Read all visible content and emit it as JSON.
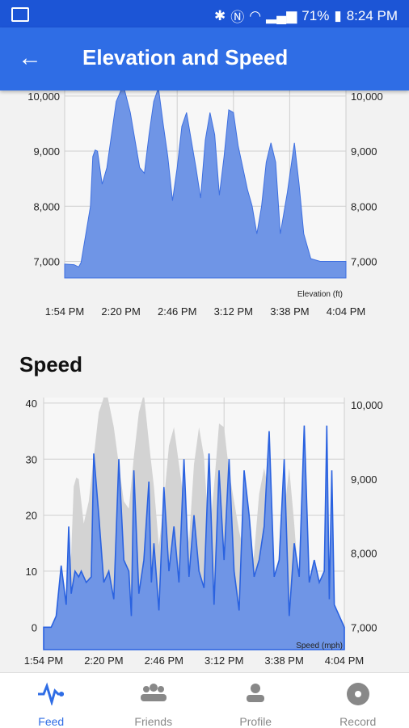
{
  "status": {
    "battery": "71%",
    "time": "8:24 PM"
  },
  "appbar": {
    "title": "Elevation and Speed",
    "back_icon": "arrow-left-icon"
  },
  "speed_section": {
    "title": "Speed"
  },
  "nav": [
    {
      "label": "Feed",
      "icon": "pulse-icon",
      "active": true
    },
    {
      "label": "Friends",
      "icon": "group-icon",
      "active": false
    },
    {
      "label": "Profile",
      "icon": "person-icon",
      "active": false
    },
    {
      "label": "Record",
      "icon": "record-icon",
      "active": false
    }
  ],
  "colors": {
    "accent": "#2f6de5",
    "elevation_fill": "#6f95e6",
    "speed_line": "#2a62e0",
    "elevation_bg": "#d3d3d3"
  },
  "chart_data": [
    {
      "type": "area",
      "caption": "Elevation (ft)",
      "x_ticks": [
        "1:54 PM",
        "2:20 PM",
        "2:46 PM",
        "3:12 PM",
        "3:38 PM",
        "4:04 PM"
      ],
      "y_ticks": [
        "7,000",
        "8,000",
        "9,000",
        "10,000"
      ],
      "ylim": [
        6700,
        10100
      ],
      "x_minutes": [
        0,
        8,
        12,
        14,
        22,
        24,
        26,
        28,
        32,
        36,
        40,
        44,
        50,
        56,
        60,
        64,
        68,
        72,
        76,
        80,
        84,
        88,
        92,
        96,
        100,
        104,
        108,
        112,
        116,
        120,
        124,
        128,
        132,
        136,
        140,
        144,
        148,
        152,
        156,
        160,
        164,
        168,
        172,
        176,
        180,
        184,
        190,
        196,
        200,
        204,
        210,
        218,
        222,
        226,
        230,
        236,
        240
      ],
      "elevation_ft": [
        6950,
        6940,
        6900,
        6980,
        8000,
        8900,
        9020,
        9000,
        8400,
        8700,
        9300,
        9900,
        10200,
        9700,
        9200,
        8700,
        8600,
        9300,
        9900,
        10150,
        9500,
        8900,
        8100,
        8700,
        9450,
        9700,
        9200,
        8700,
        8150,
        9200,
        9700,
        9300,
        8200,
        8900,
        9750,
        9700,
        9100,
        8700,
        8300,
        8000,
        7500,
        8000,
        8800,
        9150,
        8800,
        7500,
        8250,
        9150,
        8400,
        7500,
        7050,
        7000,
        7000,
        7000,
        7000,
        7000,
        7000
      ]
    },
    {
      "type": "line",
      "caption": "Speed (mph)",
      "x_ticks": [
        "1:54 PM",
        "2:20 PM",
        "2:46 PM",
        "3:12 PM",
        "3:38 PM",
        "4:04 PM"
      ],
      "y_left_ticks": [
        "0",
        "10",
        "20",
        "30",
        "40"
      ],
      "y_right_ticks": [
        "7,000",
        "8,000",
        "9,000",
        "10,000"
      ],
      "ylim_speed": [
        -4,
        41
      ],
      "ylim_elev": [
        6700,
        10100
      ],
      "x_minutes": [
        0,
        6,
        10,
        14,
        18,
        20,
        22,
        25,
        28,
        30,
        34,
        38,
        40,
        44,
        48,
        52,
        56,
        60,
        64,
        68,
        70,
        72,
        76,
        80,
        84,
        86,
        88,
        92,
        96,
        100,
        104,
        108,
        112,
        116,
        120,
        124,
        128,
        132,
        136,
        140,
        144,
        148,
        152,
        156,
        160,
        164,
        168,
        172,
        176,
        180,
        184,
        188,
        192,
        196,
        200,
        204,
        208,
        212,
        216,
        220,
        222,
        224,
        226,
        228,
        230,
        232,
        236,
        240
      ],
      "speed_mph": [
        0,
        0,
        2,
        11,
        4,
        18,
        6,
        10,
        9,
        10,
        8,
        9,
        31,
        20,
        8,
        10,
        5,
        30,
        12,
        10,
        2,
        28,
        6,
        12,
        26,
        8,
        15,
        3,
        25,
        10,
        18,
        8,
        30,
        9,
        20,
        10,
        7,
        31,
        4,
        28,
        12,
        30,
        10,
        3,
        28,
        20,
        9,
        12,
        18,
        35,
        9,
        12,
        30,
        2,
        15,
        9,
        36,
        8,
        12,
        8,
        9,
        10,
        36,
        5,
        28,
        4,
        2,
        0
      ]
    }
  ]
}
